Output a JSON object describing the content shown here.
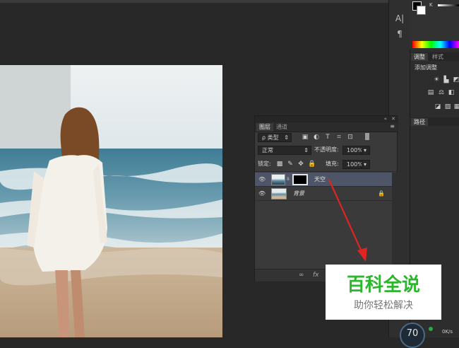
{
  "colors": {
    "accent_green": "#2db52d",
    "arrow_red": "#e02424",
    "selected_row": "#4d5566"
  },
  "toolbar_right": {
    "tools": [
      "type-icon",
      "paragraph-icon"
    ]
  },
  "color_panel": {
    "channel_letter": "K"
  },
  "adjustments": {
    "tabs": [
      {
        "label": "调整"
      },
      {
        "label": "样式"
      }
    ],
    "title": "添加调整",
    "icons": [
      "brightness-icon",
      "levels-icon",
      "curves-icon",
      "exposure-icon",
      "vibrance-icon",
      "hue-icon",
      "balance-icon",
      "bw-icon",
      "photo-filter-icon",
      "channel-mixer-icon",
      "invert-icon",
      "posterize-icon"
    ]
  },
  "paths_panel": {
    "tab": "路径"
  },
  "layers_panel": {
    "tabs": [
      {
        "label": "图层"
      },
      {
        "label": "通道"
      }
    ],
    "filter": {
      "kind_label": "ρ 类型",
      "icons": [
        "image-filter-icon",
        "adjust-filter-icon",
        "text-filter-icon",
        "shape-filter-icon",
        "smart-filter-icon",
        "toggle-filter-icon"
      ]
    },
    "blend_mode": "正常",
    "opacity": {
      "label": "不透明度:",
      "value": "100%"
    },
    "lock": {
      "label": "锁定:",
      "icons": [
        "lock-pixels-icon",
        "lock-paint-icon",
        "lock-move-icon",
        "lock-all-icon"
      ]
    },
    "fill": {
      "label": "填充:",
      "value": "100%"
    },
    "layers": [
      {
        "name": "天空",
        "selected": true,
        "has_mask": true
      },
      {
        "name": "背景",
        "selected": false,
        "locked": true
      }
    ],
    "bottom_icons": [
      "link-icon",
      "fx-icon"
    ],
    "fx_label": "fx"
  },
  "watermark": {
    "title": "百科全说",
    "subtitle": "助你轻松解决"
  },
  "dial": {
    "value": "70",
    "speed": "0K/s"
  }
}
